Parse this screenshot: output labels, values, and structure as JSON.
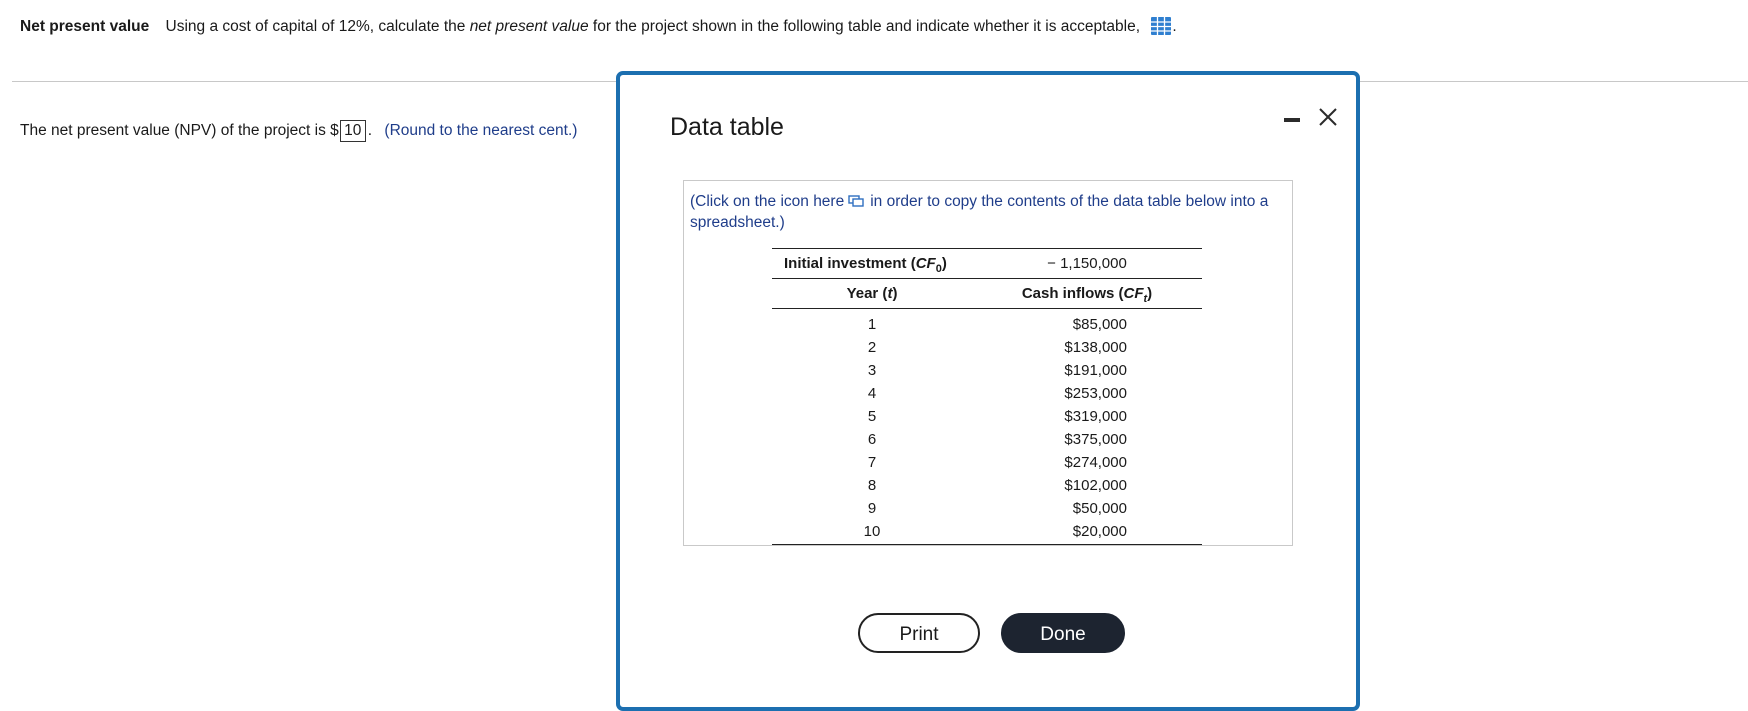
{
  "question": {
    "title": "Net present value",
    "text_before": "Using a cost of capital of 12%, calculate the ",
    "text_italic": "net present value",
    "text_after": " for the project shown in the following table and indicate whether it is acceptable,",
    "trailing": "."
  },
  "answer": {
    "prefix": "The net present value (NPV) of the project is $",
    "value": "10",
    "suffix": ".",
    "hint": "(Round to the nearest cent.)"
  },
  "modal": {
    "title": "Data table",
    "copy_note_before": "(Click on the icon here",
    "copy_note_after": "in order to copy the contents of the data table below into a spreadsheet.)",
    "table": {
      "initial_label_main": "Initial investment (",
      "initial_label_var": "CF",
      "initial_label_sub": "0",
      "initial_label_close": ")",
      "initial_value": "− 1,150,000",
      "col_year_main": "Year (",
      "col_year_var": "t",
      "col_year_close": ")",
      "col_cash_main": "Cash inflows (",
      "col_cash_var": "CF",
      "col_cash_sub": "t",
      "col_cash_close": ")",
      "rows": [
        {
          "year": "1",
          "cash": "$85,000"
        },
        {
          "year": "2",
          "cash": "$138,000"
        },
        {
          "year": "3",
          "cash": "$191,000"
        },
        {
          "year": "4",
          "cash": "$253,000"
        },
        {
          "year": "5",
          "cash": "$319,000"
        },
        {
          "year": "6",
          "cash": "$375,000"
        },
        {
          "year": "7",
          "cash": "$274,000"
        },
        {
          "year": "8",
          "cash": "$102,000"
        },
        {
          "year": "9",
          "cash": "$50,000"
        },
        {
          "year": "10",
          "cash": "$20,000"
        }
      ]
    },
    "print_label": "Print",
    "done_label": "Done"
  }
}
